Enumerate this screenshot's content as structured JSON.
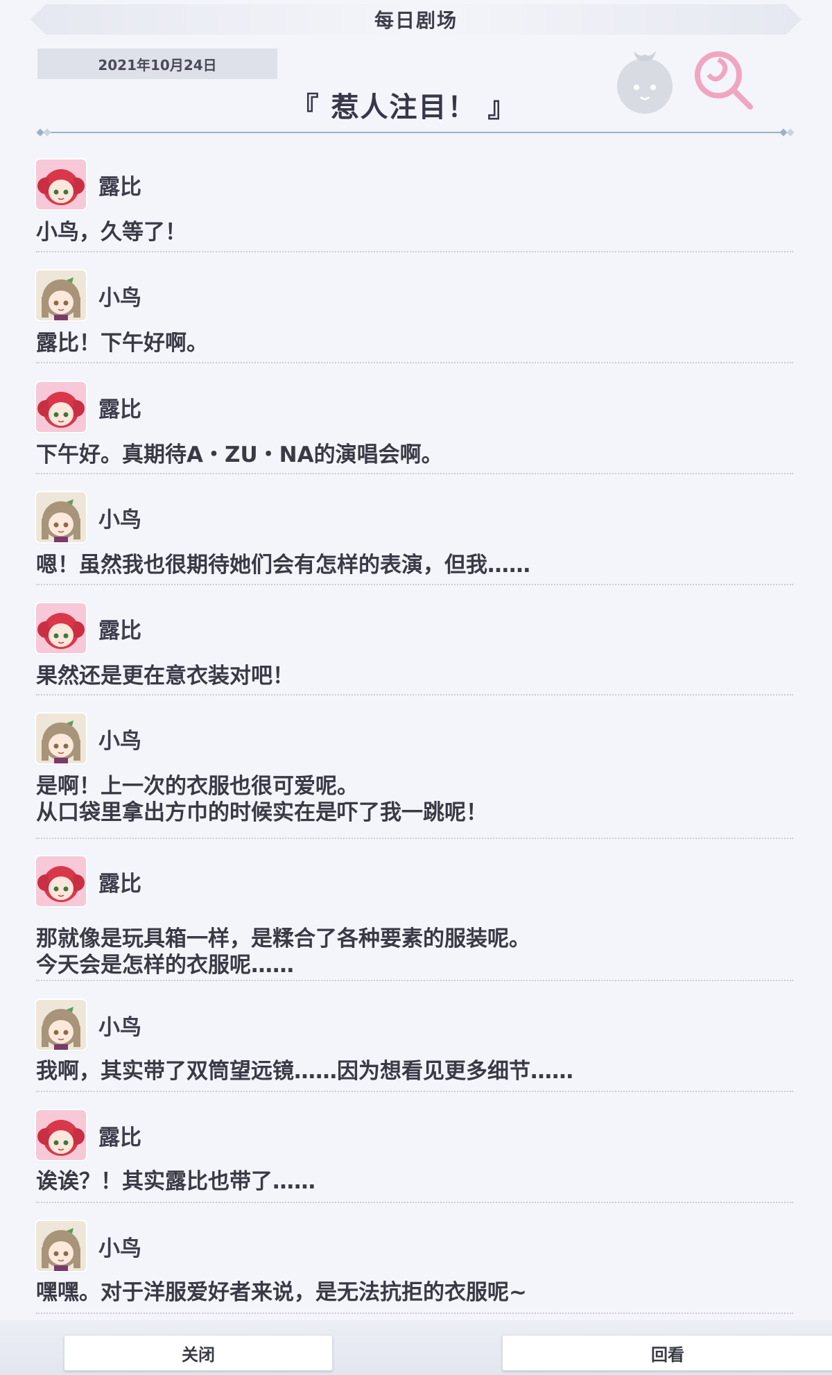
{
  "header": {
    "title": "每日剧场"
  },
  "date": "2021年10月24日",
  "story_title": "『 惹人注目！ 』",
  "colors": {
    "page_bg": "#f3f5fa",
    "divider": "#c9ccd8",
    "accent_teal": "#8fa3b8",
    "candy_pink": "#f0a6c0"
  },
  "characters": {
    "ruby": {
      "name": "露比",
      "avatar_icon": "ruby-avatar-icon"
    },
    "kotori": {
      "name": "小鸟",
      "avatar_icon": "kotori-avatar-icon"
    }
  },
  "dialogues": [
    {
      "speaker": "ruby",
      "name": "露比",
      "lines": [
        "小鸟，久等了！"
      ]
    },
    {
      "speaker": "kotori",
      "name": "小鸟",
      "lines": [
        "露比！下午好啊。"
      ]
    },
    {
      "speaker": "ruby",
      "name": "露比",
      "lines": [
        "下午好。真期待A・ZU・NA的演唱会啊。"
      ]
    },
    {
      "speaker": "kotori",
      "name": "小鸟",
      "lines": [
        "嗯！虽然我也很期待她们会有怎样的表演，但我……"
      ]
    },
    {
      "speaker": "ruby",
      "name": "露比",
      "lines": [
        "果然还是更在意衣装对吧！"
      ]
    },
    {
      "speaker": "kotori",
      "name": "小鸟",
      "lines": [
        "是啊！上一次的衣服也很可爱呢。",
        "从口袋里拿出方巾的时候实在是吓了我一跳呢！"
      ]
    },
    {
      "speaker": "ruby",
      "name": "露比",
      "lines": [
        "那就像是玩具箱一样，是糅合了各种要素的服装呢。",
        "今天会是怎样的衣服呢……"
      ]
    },
    {
      "speaker": "kotori",
      "name": "小鸟",
      "lines": [
        "我啊，其实带了双筒望远镜……因为想看见更多细节……"
      ]
    },
    {
      "speaker": "ruby",
      "name": "露比",
      "lines": [
        "诶诶？！其实露比也带了……"
      ]
    },
    {
      "speaker": "kotori",
      "name": "小鸟",
      "lines": [
        "嘿嘿。对于洋服爱好者来说，是无法抗拒的衣服呢~"
      ]
    }
  ],
  "footer": {
    "close_label": "关闭",
    "replay_label": "回看"
  },
  "decorations": {
    "bun_icon": "bun-mascot-icon",
    "candy_icon": "lollipop-icon"
  }
}
